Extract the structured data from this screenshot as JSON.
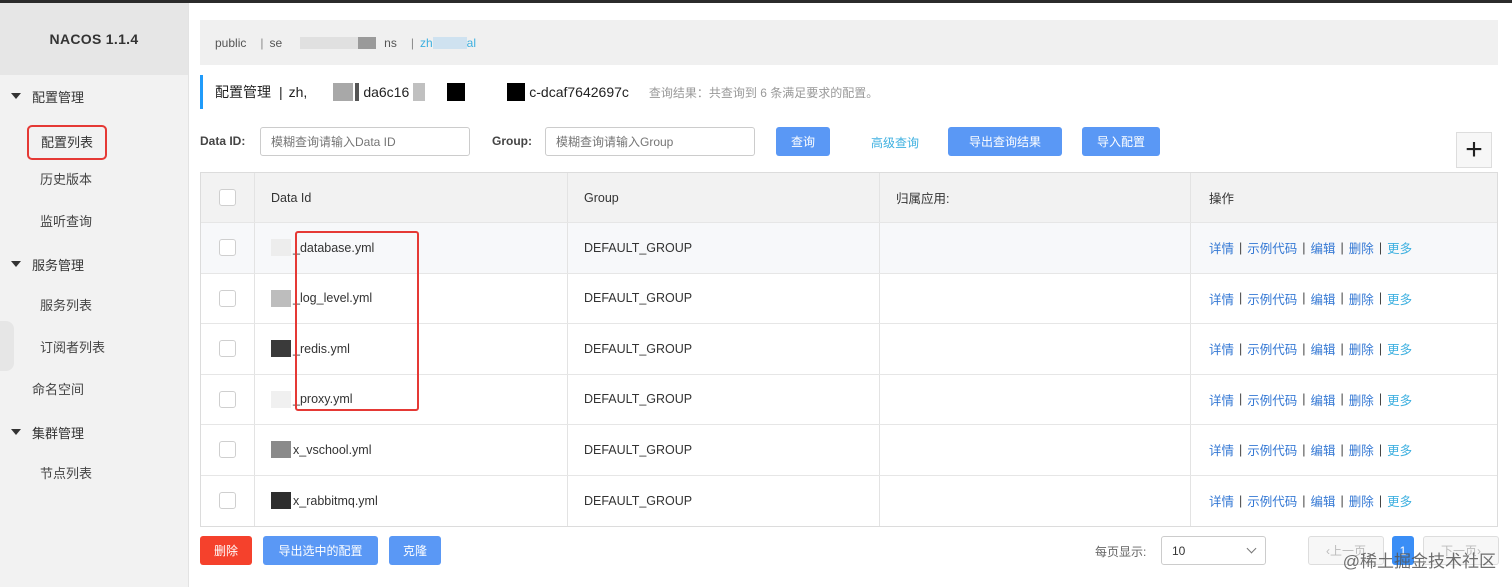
{
  "app": {
    "title": "NACOS 1.1.4"
  },
  "sidebar": {
    "groups": [
      {
        "label": "配置管理",
        "items": [
          "配置列表",
          "历史版本",
          "监听查询"
        ]
      },
      {
        "label": "服务管理",
        "items": [
          "服务列表",
          "订阅者列表"
        ]
      },
      {
        "label": "命名空间",
        "items": []
      },
      {
        "label": "集群管理",
        "items": [
          "节点列表"
        ]
      }
    ],
    "active_item": "配置列表"
  },
  "namespace_bar": {
    "public": "public",
    "ns2": "se",
    "ns2_tail": "ns",
    "ns3": "zh",
    "ns3_tail": "al"
  },
  "header": {
    "title": "配置管理",
    "separator": "|",
    "ns_prefix": "zh,",
    "ns_mid": "da6c16",
    "ns_tail": "c-dcaf7642697c",
    "result": "查询结果：共查询到 6 条满足要求的配置。"
  },
  "filter": {
    "dataid_label": "Data ID:",
    "dataid_placeholder": "模糊查询请输入Data ID",
    "group_label": "Group:",
    "group_placeholder": "模糊查询请输入Group",
    "search_btn": "查询",
    "advanced_link": "高级查询",
    "export_result_btn": "导出查询结果",
    "import_btn": "导入配置",
    "add_icon": "+"
  },
  "table": {
    "columns": [
      "Data Id",
      "Group",
      "归属应用:",
      "操作"
    ],
    "rows": [
      {
        "data_id": "_database.yml",
        "group": "DEFAULT_GROUP",
        "app": ""
      },
      {
        "data_id": "_log_level.yml",
        "group": "DEFAULT_GROUP",
        "app": ""
      },
      {
        "data_id": "_redis.yml",
        "group": "DEFAULT_GROUP",
        "app": ""
      },
      {
        "data_id": "_proxy.yml",
        "group": "DEFAULT_GROUP",
        "app": ""
      },
      {
        "data_id": "x_vschool.yml",
        "group": "DEFAULT_GROUP",
        "app": ""
      },
      {
        "data_id": "x_rabbitmq.yml",
        "group": "DEFAULT_GROUP",
        "app": ""
      }
    ],
    "actions": {
      "detail": "详情",
      "sample": "示例代码",
      "edit": "编辑",
      "delete": "删除",
      "more": "更多",
      "sep": "|"
    }
  },
  "bottom": {
    "delete_btn": "删除",
    "export_selected_btn": "导出选中的配置",
    "clone_btn": "克隆",
    "page_size_label": "每页显示:",
    "page_size": "10",
    "prev": "上一页",
    "page": "1",
    "next": "下一页"
  },
  "watermark": "@稀土掘金技术社区",
  "colors": {
    "primary": "#5a98f5",
    "danger": "#f5412c",
    "link": "#3eb0e0",
    "accent": "#209bfa"
  }
}
